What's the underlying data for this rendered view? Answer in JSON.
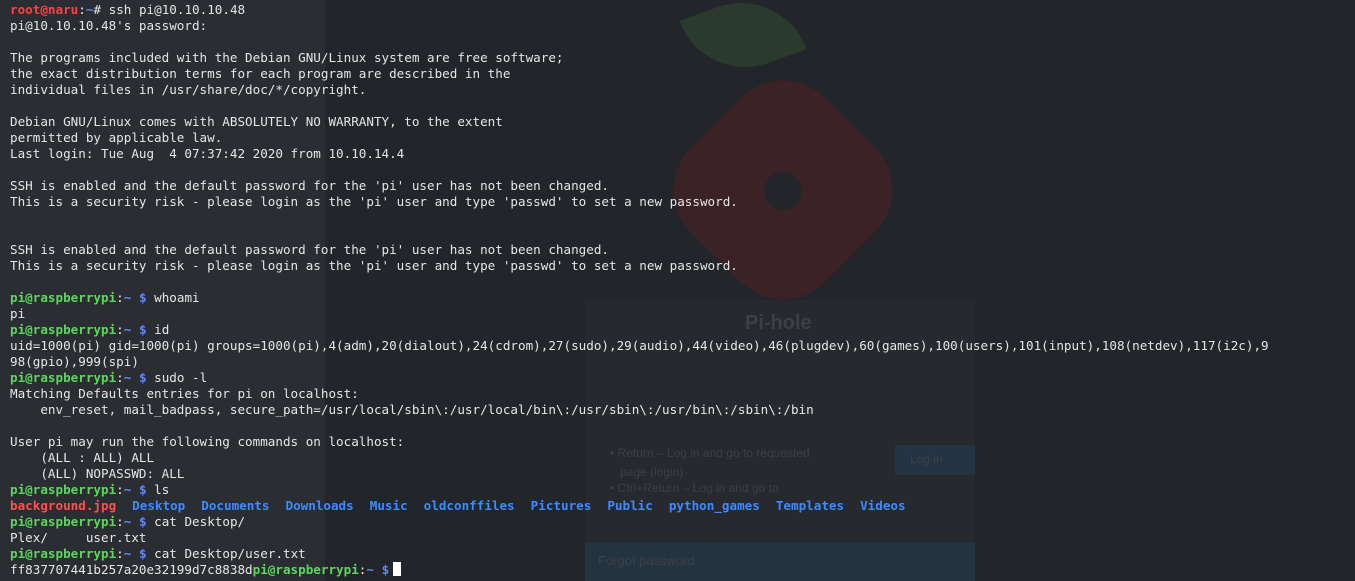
{
  "background_page": {
    "title": "Pi-hole",
    "hint_return": "• Return – Log in and go to requested",
    "hint_return_cont": "page (login)",
    "hint_ctrl_return": "• Ctrl+Return – Log in and go to",
    "login_button": "Log in",
    "forgot_password": "Forgot password"
  },
  "terminal": {
    "root_prompt": {
      "user": "root@naru",
      "path": "~",
      "symbol": "#"
    },
    "pi_prompt": {
      "user": "pi@raspberrypi",
      "path": "~",
      "symbol": "$"
    },
    "ssh_command": "ssh pi@10.10.10.48",
    "password_prompt": "pi@10.10.10.48's password:",
    "motd_1": "The programs included with the Debian GNU/Linux system are free software;",
    "motd_2": "the exact distribution terms for each program are described in the",
    "motd_3": "individual files in /usr/share/doc/*/copyright.",
    "motd_4": "Debian GNU/Linux comes with ABSOLUTELY NO WARRANTY, to the extent",
    "motd_5": "permitted by applicable law.",
    "last_login": "Last login: Tue Aug  4 07:37:42 2020 from 10.10.14.4",
    "ssh_warning_1": "SSH is enabled and the default password for the 'pi' user has not been changed.",
    "ssh_warning_2": "This is a security risk - please login as the 'pi' user and type 'passwd' to set a new password.",
    "cmd_whoami": "whoami",
    "out_whoami": "pi",
    "cmd_id": "id",
    "out_id_1": "uid=1000(pi) gid=1000(pi) groups=1000(pi),4(adm),20(dialout),24(cdrom),27(sudo),29(audio),44(video),46(plugdev),60(games),100(users),101(input),108(netdev),117(i2c),9",
    "out_id_2": "98(gpio),999(spi)",
    "cmd_sudo": "sudo -l",
    "out_sudo_1": "Matching Defaults entries for pi on localhost:",
    "out_sudo_2": "    env_reset, mail_badpass, secure_path=/usr/local/sbin\\:/usr/local/bin\\:/usr/sbin\\:/usr/bin\\:/sbin\\:/bin",
    "out_sudo_3": "User pi may run the following commands on localhost:",
    "out_sudo_4": "    (ALL : ALL) ALL",
    "out_sudo_5": "    (ALL) NOPASSWD: ALL",
    "cmd_ls": "ls",
    "ls_image": "background.jpg",
    "ls_dirs": [
      "Desktop",
      "Documents",
      "Downloads",
      "Music",
      "oldconffiles",
      "Pictures",
      "Public",
      "python_games",
      "Templates",
      "Videos"
    ],
    "cmd_cat_dir": "cat Desktop/",
    "out_cat_dir": "Plex/     user.txt",
    "cmd_cat_file": "cat Desktop/user.txt",
    "out_flag": "ff837707441b257a20e32199d7c8838d"
  },
  "colors": {
    "terminal_bg": "#1b1e22",
    "root_prompt": "#ff4040",
    "user_prompt": "#5fd75f",
    "path": "#5f87ff",
    "directory": "#3d8bff",
    "image_file": "#ff4f4f"
  }
}
